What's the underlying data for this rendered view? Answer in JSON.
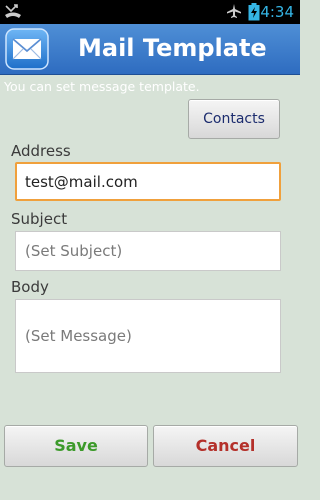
{
  "status_bar": {
    "time": "4:34",
    "icons": [
      "missed-call-icon",
      "airplane-mode-icon",
      "battery-charging-icon"
    ],
    "accent_color": "#35b5e5"
  },
  "app": {
    "title": "Mail Template",
    "icon": "mail-envelope-icon",
    "header_color": "#3d7ccb"
  },
  "hint_text": "You can set message template.",
  "contacts_button": "Contacts",
  "form": {
    "address": {
      "label": "Address",
      "value": "test@mail.com"
    },
    "subject": {
      "label": "Subject",
      "placeholder": "(Set Subject)"
    },
    "body": {
      "label": "Body",
      "placeholder": "(Set Message)"
    }
  },
  "actions": {
    "save_label": "Save",
    "cancel_label": "Cancel",
    "save_color": "#3c9a2a",
    "cancel_color": "#b4302a"
  }
}
